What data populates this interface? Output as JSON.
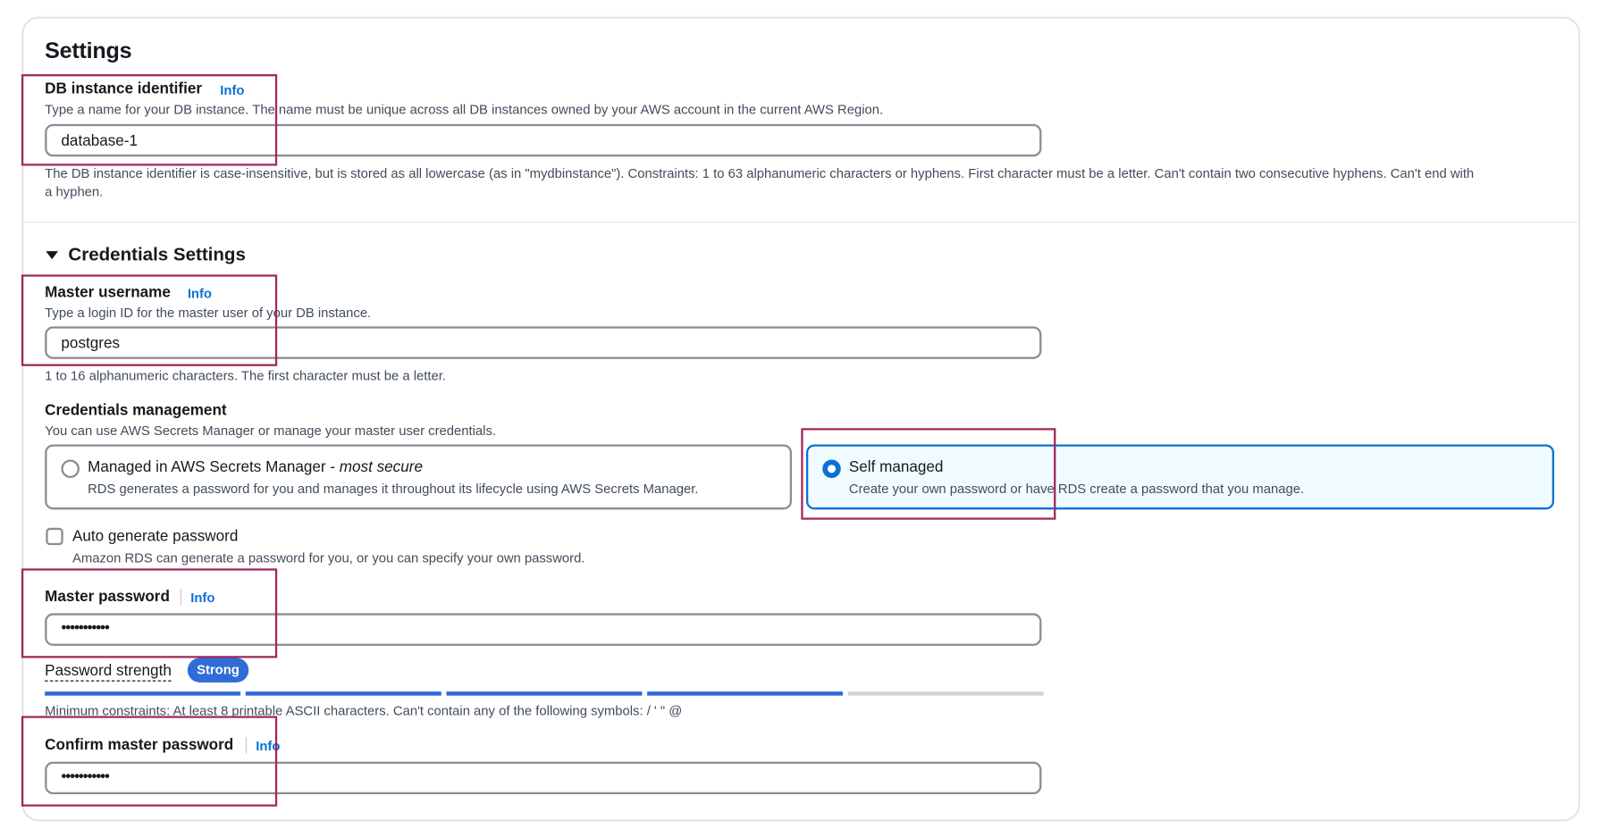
{
  "settings": {
    "title": "Settings",
    "db_identifier": {
      "label": "DB instance identifier",
      "info": "Info",
      "description": "Type a name for your DB instance. The name must be unique across all DB instances owned by your AWS account in the current AWS Region.",
      "value": "database-1",
      "constraint_line1": "The DB instance identifier is case-insensitive, but is stored as all lowercase (as in \"mydbinstance\"). Constraints: 1 to 63 alphanumeric characters or hyphens. First character must be a letter. Can't contain two consecutive hyphens. Can't end with",
      "constraint_line2": "a hyphen."
    }
  },
  "credentials": {
    "section_title": "Credentials Settings",
    "toggle_icon": "caret-down-icon",
    "master_username": {
      "label": "Master username",
      "info": "Info",
      "description": "Type a login ID for the master user of your DB instance.",
      "value": "postgres",
      "constraint": "1 to 16 alphanumeric characters. The first character must be a letter."
    },
    "management": {
      "label": "Credentials management",
      "description": "You can use AWS Secrets Manager or manage your master user credentials.",
      "options": [
        {
          "title": "Managed in AWS Secrets Manager - ",
          "title_em": "most secure",
          "description": "RDS generates a password for you and manages it throughout its lifecycle using AWS Secrets Manager.",
          "selected": false
        },
        {
          "title": "Self managed",
          "title_em": "",
          "description": "Create your own password or have RDS create a password that you manage.",
          "selected": true
        }
      ]
    },
    "auto_generate": {
      "label": "Auto generate password",
      "description": "Amazon RDS can generate a password for you, or you can specify your own password.",
      "checked": false
    },
    "master_password": {
      "label": "Master password",
      "info": "Info",
      "value": "•••••••••••",
      "strength_label": "Password strength",
      "strength_badge": "Strong",
      "strength_segments_filled": 4,
      "strength_segments_total": 5,
      "constraint": "Minimum constraints: At least 8 printable ASCII characters. Can't contain any of the following symbols: / ' \" @"
    },
    "confirm_password": {
      "label": "Confirm master password",
      "info": "Info",
      "value": "•••••••••••"
    }
  },
  "colors": {
    "accent": "#0972d3",
    "strength_bar": "#2f6cd8",
    "strength_empty": "#d1d5db",
    "badge_bg": "#2f6cd8",
    "highlight_border": "#a0285a",
    "selected_tile_bg": "#f0fbff"
  }
}
